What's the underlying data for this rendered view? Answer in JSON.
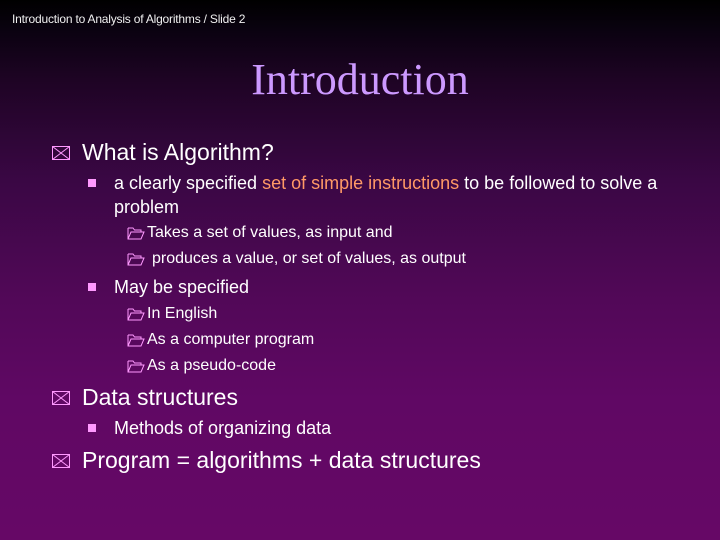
{
  "header": {
    "text": "Introduction to Analysis of Algorithms / Slide 2"
  },
  "title": "Introduction",
  "colors": {
    "title": "#cc99ff",
    "highlight": "#ff9966",
    "bullet": "#ff99ff",
    "background": "#660866"
  },
  "bullets": [
    {
      "icon": "envelope-x-icon",
      "text": "What is Algorithm?",
      "subitems": [
        {
          "icon": "square-bullet-icon",
          "pre": "a clearly specified ",
          "highlight": "set of simple instructions",
          "post": " to be followed to solve a problem",
          "subitems": [
            {
              "icon": "open-folder-icon",
              "text": "Takes a set of values, as input and"
            },
            {
              "icon": "open-folder-icon",
              "text": "produces a value, or set of values, as output"
            }
          ]
        },
        {
          "icon": "square-bullet-icon",
          "text": "May be specified",
          "subitems": [
            {
              "icon": "open-folder-icon",
              "text": "In English"
            },
            {
              "icon": "open-folder-icon",
              "text": "As a computer program"
            },
            {
              "icon": "open-folder-icon",
              "text": "As a pseudo-code"
            }
          ]
        }
      ]
    },
    {
      "icon": "envelope-x-icon",
      "text": "Data structures",
      "subitems": [
        {
          "icon": "square-bullet-icon",
          "text": "Methods of organizing data"
        }
      ]
    },
    {
      "icon": "envelope-x-icon",
      "text": "Program = algorithms + data structures"
    }
  ]
}
